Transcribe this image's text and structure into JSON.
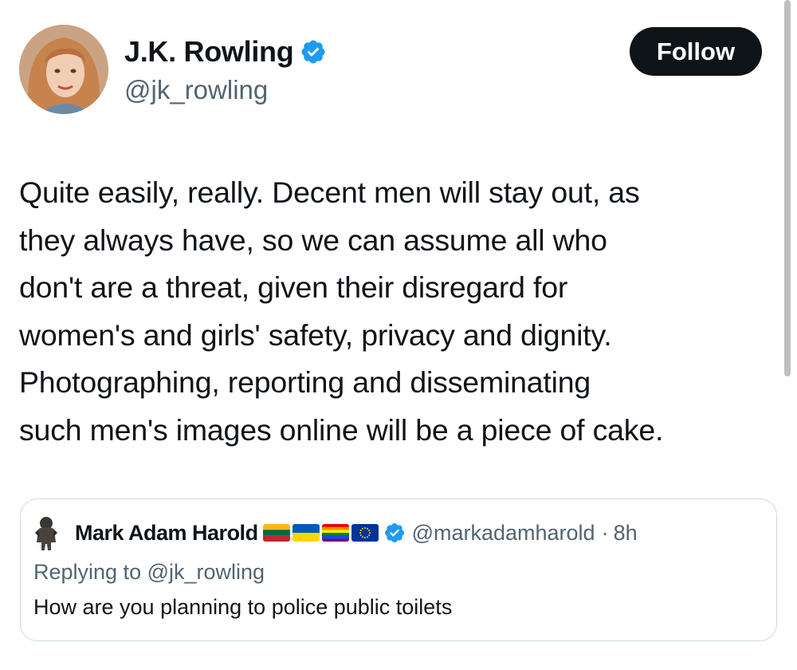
{
  "author": {
    "display_name": "J.K. Rowling",
    "handle": "@jk_rowling",
    "verified": true,
    "avatar": "profile-photo"
  },
  "follow_button": {
    "label": "Follow"
  },
  "tweet": {
    "text": "Quite easily, really. Decent men will stay out, as\nthey always have, so we can assume all who\ndon't are a threat, given their disregard for\nwomen's and girls' safety, privacy and dignity.\nPhotographing, reporting and disseminating\nsuch men's images online will be a piece of cake."
  },
  "quoted": {
    "display_name": "Mark Adam Harold",
    "flags": [
      "lithuania-flag",
      "ukraine-flag",
      "rainbow-flag",
      "eu-flag"
    ],
    "verified": true,
    "handle": "@markadamharold",
    "separator": "·",
    "time": "8h",
    "replying_to": "Replying to @jk_rowling",
    "text": "How are you planning to police public toilets"
  },
  "colors": {
    "text_primary": "#0f1419",
    "text_secondary": "#536471",
    "verified_blue": "#1d9bf0",
    "button_bg": "#0f1419",
    "border": "#cfd9de"
  }
}
